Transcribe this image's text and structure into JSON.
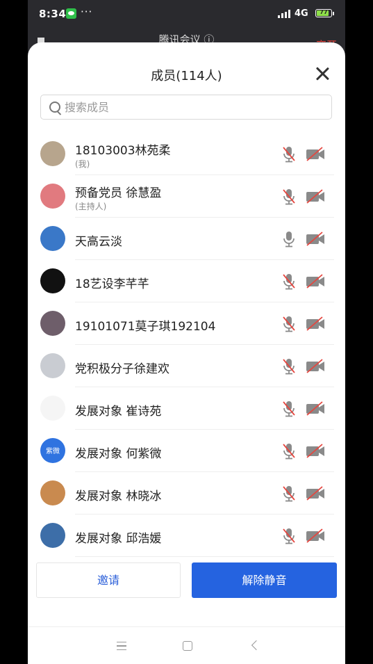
{
  "status_bar": {
    "time": "8:34",
    "dots": "···",
    "network": "4G",
    "battery": "77"
  },
  "meeting": {
    "title": "腾讯会议 ⓘ",
    "leave_label": "离开"
  },
  "sheet": {
    "title": "成员(114人)"
  },
  "search": {
    "placeholder": "搜索成员"
  },
  "members": [
    {
      "name": "18103003林苑柔",
      "role": "(我)",
      "avatar": "photo-portrait-icon",
      "avatar_color": "#b7a58d",
      "mic_muted": true,
      "cam_off": true
    },
    {
      "name": "预备党员 徐慧盈",
      "role": "(主持人)",
      "avatar": "pink-circle-icon",
      "avatar_color": "#e17a7f",
      "mic_muted": true,
      "cam_off": true
    },
    {
      "name": "天高云淡",
      "role": "",
      "avatar": "sky-landscape-icon",
      "avatar_color": "#3a78c8",
      "mic_muted": false,
      "cam_off": true
    },
    {
      "name": "18艺设李芊芊",
      "role": "",
      "avatar": "butterfly-icon",
      "avatar_color": "#111111",
      "mic_muted": true,
      "cam_off": true
    },
    {
      "name": "19101071莫子琪192104",
      "role": "",
      "avatar": "dog-photo-icon",
      "avatar_color": "#6e5e6a",
      "mic_muted": true,
      "cam_off": true
    },
    {
      "name": "党积极分子徐建欢",
      "role": "",
      "avatar": "cat-photo-icon",
      "avatar_color": "#c9ccd2",
      "mic_muted": true,
      "cam_off": true
    },
    {
      "name": "发展对象 崔诗苑",
      "role": "",
      "avatar": "cartoon-girl-icon",
      "avatar_color": "#f5f5f5",
      "mic_muted": true,
      "cam_off": true
    },
    {
      "name": "发展对象 何紫微",
      "role": "",
      "avatar": "text-avatar-icon",
      "avatar_color": "#2f73e0",
      "avatar_text": "紫微",
      "mic_muted": true,
      "cam_off": true
    },
    {
      "name": "发展对象 林晓冰",
      "role": "",
      "avatar": "tree-art-icon",
      "avatar_color": "#c98a4f",
      "mic_muted": true,
      "cam_off": true
    },
    {
      "name": "发展对象 邱浩媛",
      "role": "",
      "avatar": "bunny-toy-icon",
      "avatar_color": "#3d6ea8",
      "mic_muted": true,
      "cam_off": true
    }
  ],
  "buttons": {
    "invite": "邀请",
    "unmute_all": "解除静音"
  },
  "colors": {
    "accent": "#2563e0",
    "muted_red": "#e5463f",
    "icon_gray": "#8a8a8a"
  }
}
